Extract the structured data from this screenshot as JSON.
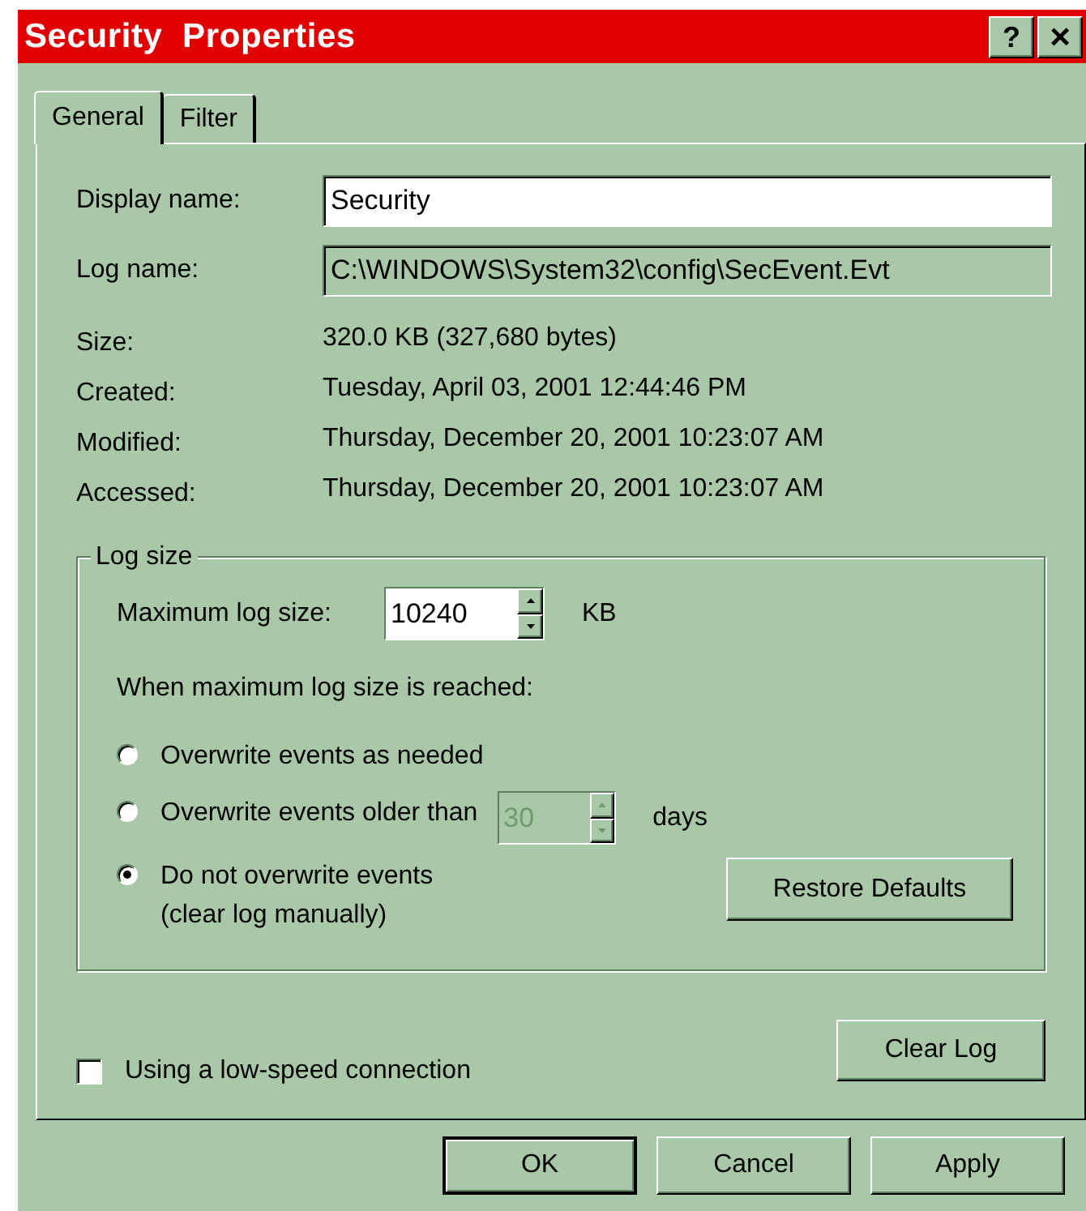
{
  "window": {
    "title": "Security  Properties",
    "help": "?",
    "close": "×"
  },
  "tabs": [
    {
      "label": "General",
      "selected": true
    },
    {
      "label": "Filter",
      "selected": false
    }
  ],
  "display_name": {
    "label": "Display name:",
    "value": "Security"
  },
  "log_name": {
    "label": "Log name:",
    "value": "C:\\WINDOWS\\System32\\config\\SecEvent.Evt"
  },
  "info": [
    {
      "label": "Size:",
      "value": "320.0 KB (327,680 bytes)"
    },
    {
      "label": "Created:",
      "value": "Tuesday, April 03, 2001 12:44:46 PM"
    },
    {
      "label": "Modified:",
      "value": "Thursday, December 20, 2001 10:23:07 AM"
    },
    {
      "label": "Accessed:",
      "value": "Thursday, December 20, 2001 10:23:07 AM"
    }
  ],
  "log_size": {
    "title": "Log size",
    "max_label": "Maximum log size:",
    "max_value": "10240",
    "max_unit": "KB",
    "when_label": "When maximum log size is reached:",
    "options": [
      {
        "kind": "plain",
        "label": "Overwrite events as needed",
        "selected": false
      },
      {
        "kind": "days",
        "label": "Overwrite events older than",
        "selected": false,
        "days_value": "30",
        "days_disabled": true,
        "days_unit": "days"
      },
      {
        "kind": "plain",
        "label": "Do not overwrite events",
        "note": "(clear log manually)",
        "selected": true
      }
    ],
    "restore": "Restore Defaults"
  },
  "low_speed": {
    "label": "Using a low-speed connection",
    "checked": false
  },
  "clear_log": "Clear Log",
  "buttons": [
    {
      "label": "OK",
      "default": true
    },
    {
      "label": "Cancel",
      "default": false
    },
    {
      "label": "Apply",
      "default": false
    }
  ]
}
